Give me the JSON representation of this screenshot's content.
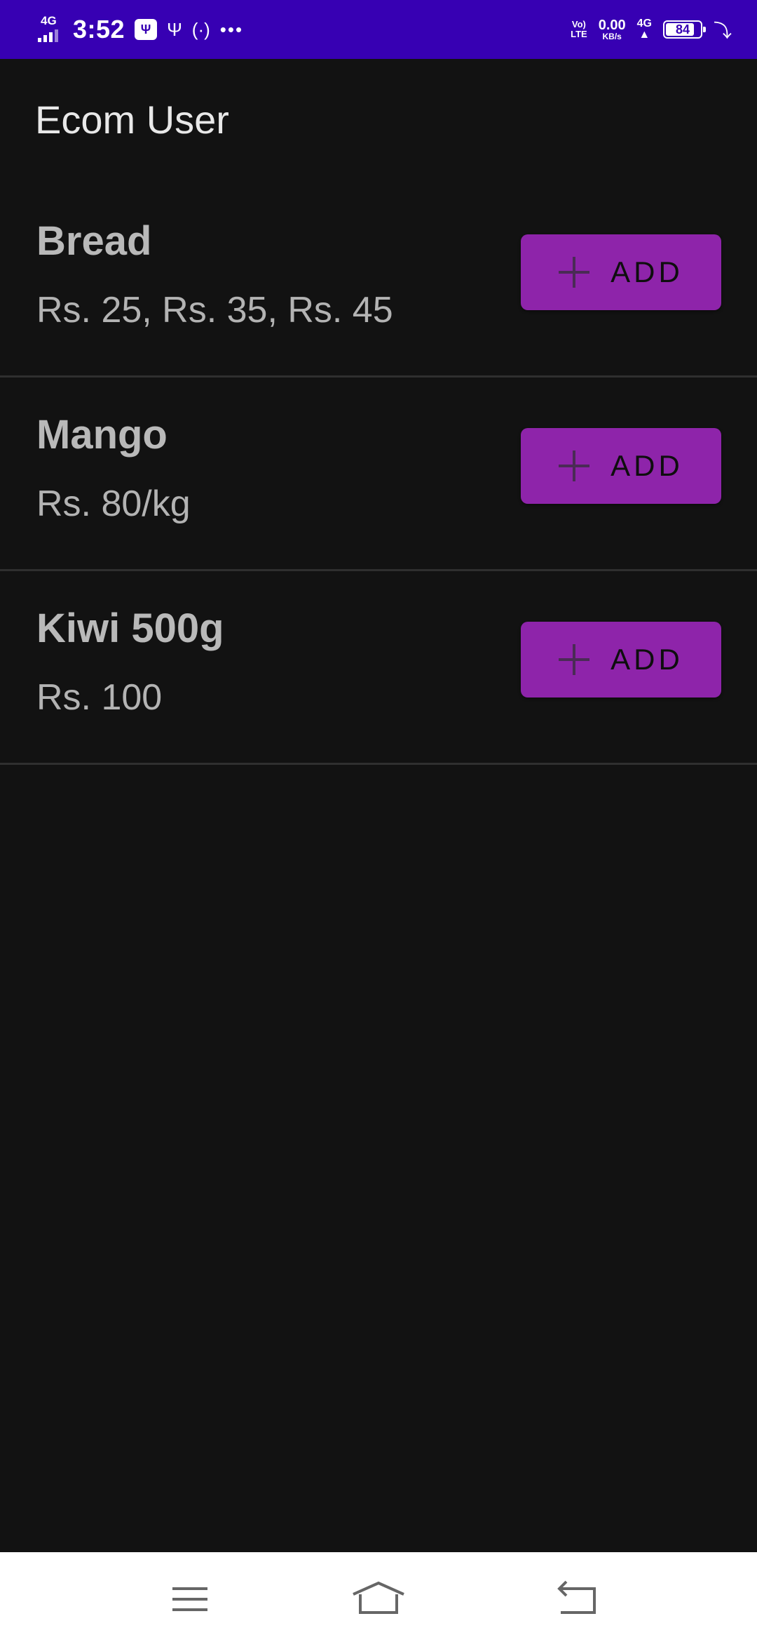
{
  "status_bar": {
    "network_left": "4G",
    "time": "3:52",
    "notif_icon": "usb-debug-icon",
    "usb_icon": "usb-icon",
    "hotspot_icon": "hotspot-icon",
    "more": "•••",
    "volte": "Vo) LTE",
    "speed_value": "0.00",
    "speed_unit": "KB/s",
    "network_right": "4G",
    "battery_percent": "84",
    "charging_icon": "bolt-icon"
  },
  "app_bar": {
    "title": "Ecom User"
  },
  "products": [
    {
      "name": "Bread",
      "price": "Rs. 25,  Rs. 35,  Rs. 45",
      "button_label": "ADD"
    },
    {
      "name": "Mango",
      "price": "Rs. 80/kg",
      "button_label": "ADD"
    },
    {
      "name": "Kiwi 500g",
      "price": "Rs. 100",
      "button_label": "ADD"
    }
  ],
  "nav_bar": {
    "menu_icon": "menu-icon",
    "home_icon": "home-icon",
    "back_icon": "back-icon"
  },
  "colors": {
    "status_bar": "#3700b3",
    "background": "#121212",
    "accent_button": "#8e24aa",
    "nav_bar": "#ffffff"
  }
}
